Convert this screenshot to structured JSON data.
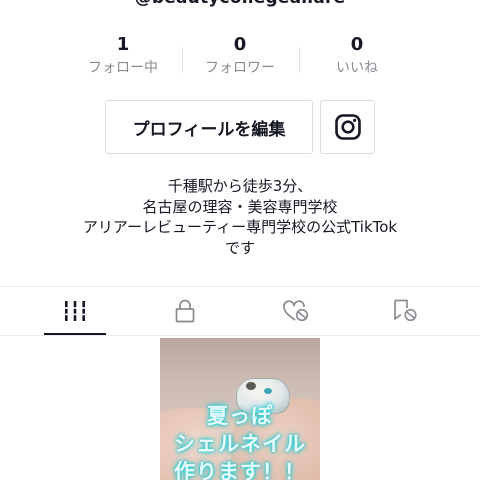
{
  "profile": {
    "handle": "@beautycollegeallare"
  },
  "stats": [
    {
      "value": "1",
      "label": "フォロー中"
    },
    {
      "value": "0",
      "label": "フォロワー"
    },
    {
      "value": "0",
      "label": "いいね"
    }
  ],
  "actions": {
    "edit_profile_label": "プロフィールを編集",
    "instagram_icon": "instagram-icon"
  },
  "bio": {
    "lines": [
      "千種駅から徒歩3分、",
      "名古屋の理容・美容専門学校",
      "アリアーレビューティー専門学校の公式TikTok",
      "です"
    ]
  },
  "tabs": [
    {
      "icon": "grid-videos-icon",
      "active": true
    },
    {
      "icon": "lock-icon",
      "active": false
    },
    {
      "icon": "liked-hidden-icon",
      "active": false
    },
    {
      "icon": "tagged-hidden-icon",
      "active": false
    }
  ],
  "video": {
    "caption_lines": [
      "夏っぽ",
      "シェルネイル",
      "作ります！！"
    ]
  },
  "colors": {
    "text": "#161823",
    "secondary": "#8a8b91",
    "border": "#dcdcdd",
    "caption_glow": "#28d6d6"
  }
}
